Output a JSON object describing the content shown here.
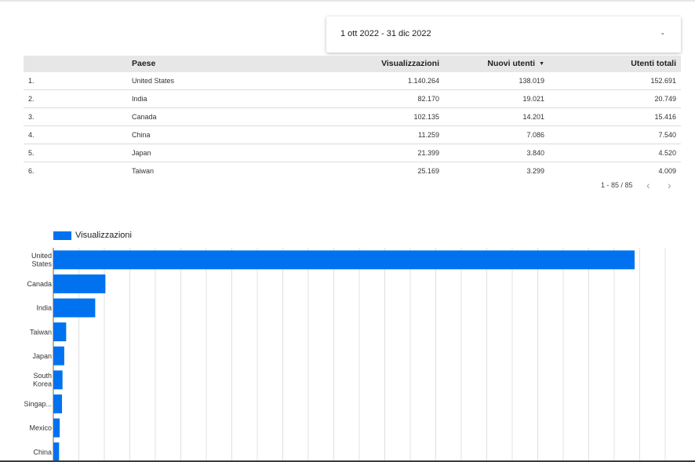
{
  "date_range": {
    "label": "1 ott 2022 - 31 dic 2022",
    "dropdown_icon": "dropdown-icon"
  },
  "table": {
    "headers": {
      "country": "Paese",
      "views": "Visualizzazioni",
      "new_users": "Nuovi utenti",
      "total_users": "Utenti totali"
    },
    "sort_icon": "sort-descending-icon",
    "rows": [
      {
        "index": "1.",
        "country": "United States",
        "views": "1.140.264",
        "new_users": "138.019",
        "total_users": "152.691"
      },
      {
        "index": "2.",
        "country": "India",
        "views": "82.170",
        "new_users": "19.021",
        "total_users": "20.749"
      },
      {
        "index": "3.",
        "country": "Canada",
        "views": "102.135",
        "new_users": "14.201",
        "total_users": "15.416"
      },
      {
        "index": "4.",
        "country": "China",
        "views": "11.259",
        "new_users": "7.086",
        "total_users": "7.540"
      },
      {
        "index": "5.",
        "country": "Japan",
        "views": "21.399",
        "new_users": "3.840",
        "total_users": "4.520"
      },
      {
        "index": "6.",
        "country": "Taiwan",
        "views": "25.169",
        "new_users": "3.299",
        "total_users": "4.009"
      }
    ],
    "pagination": "1 - 85 / 85",
    "prev_icon": "chevron-left-icon",
    "next_icon": "chevron-right-icon"
  },
  "chart_data": {
    "type": "bar",
    "orientation": "horizontal",
    "legend": [
      "Visualizzazioni"
    ],
    "legend_position": "top-left",
    "color": "#0072f0",
    "grid": true,
    "categories": [
      "United States",
      "Canada",
      "India",
      "Taiwan",
      "Japan",
      "South Korea",
      "Singap...",
      "Mexico",
      "China"
    ],
    "category_labels": [
      [
        "United",
        "States"
      ],
      [
        "Canada"
      ],
      [
        "India"
      ],
      [
        "Taiwan"
      ],
      [
        "Japan"
      ],
      [
        "South",
        "Korea"
      ],
      [
        "Singap..."
      ],
      [
        "Mexico"
      ],
      [
        "China"
      ]
    ],
    "series": [
      {
        "name": "Visualizzazioni",
        "values": [
          1140264,
          102135,
          82170,
          25169,
          21399,
          18000,
          17000,
          12500,
          11259
        ]
      }
    ],
    "xlim": [
      0,
      1200000
    ]
  }
}
